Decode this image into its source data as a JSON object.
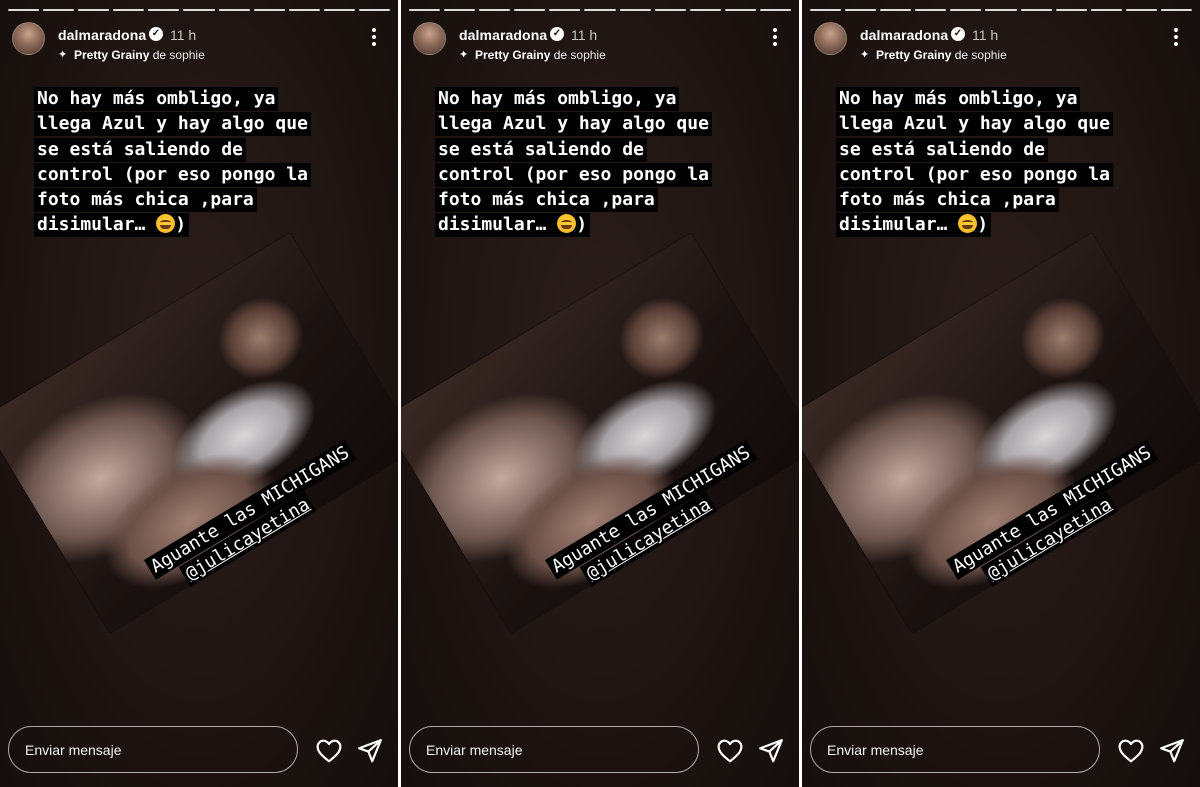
{
  "stories": [
    {
      "username": "dalmaradona",
      "time": "11 h",
      "music": {
        "song": "Pretty Grainy",
        "separator": " de ",
        "artist": "sophie"
      },
      "caption_lines": [
        "No hay más ombligo, ya",
        "llega Azul y hay algo que",
        "se está saliendo de",
        "control (por eso pongo la",
        "foto más chica ,para",
        "disimular…"
      ],
      "caption_end": ")",
      "sticker_lines": [
        "Aguante las MICHIGANS",
        "@julicayetina"
      ],
      "reply_placeholder": "Enviar mensaje"
    },
    {
      "username": "dalmaradona",
      "time": "11 h",
      "music": {
        "song": "Pretty Grainy",
        "separator": " de ",
        "artist": "sophie"
      },
      "caption_lines": [
        "No hay más ombligo, ya",
        "llega Azul y hay algo que",
        "se está saliendo de",
        "control (por eso pongo la",
        "foto más chica ,para",
        "disimular…"
      ],
      "caption_end": ")",
      "sticker_lines": [
        "Aguante las MICHIGANS",
        "@julicayetina"
      ],
      "reply_placeholder": "Enviar mensaje"
    },
    {
      "username": "dalmaradona",
      "time": "11 h",
      "music": {
        "song": "Pretty Grainy",
        "separator": " de ",
        "artist": "sophie"
      },
      "caption_lines": [
        "No hay más ombligo, ya",
        "llega Azul y hay algo que",
        "se está saliendo de",
        "control (por eso pongo la",
        "foto más chica ,para",
        "disimular…"
      ],
      "caption_end": ")",
      "sticker_lines": [
        "Aguante las MICHIGANS",
        "@julicayetina"
      ],
      "reply_placeholder": "Enviar mensaje"
    }
  ],
  "icons": {
    "verified": "verified-badge-icon",
    "music": "sparkle-music-icon",
    "more": "more-options-icon",
    "like": "heart-icon",
    "share": "send-icon",
    "emoji": "rolling-laughing-emoji"
  },
  "colors": {
    "caption_bg": "#000000",
    "text": "#ffffff",
    "background": "#1f1512"
  }
}
